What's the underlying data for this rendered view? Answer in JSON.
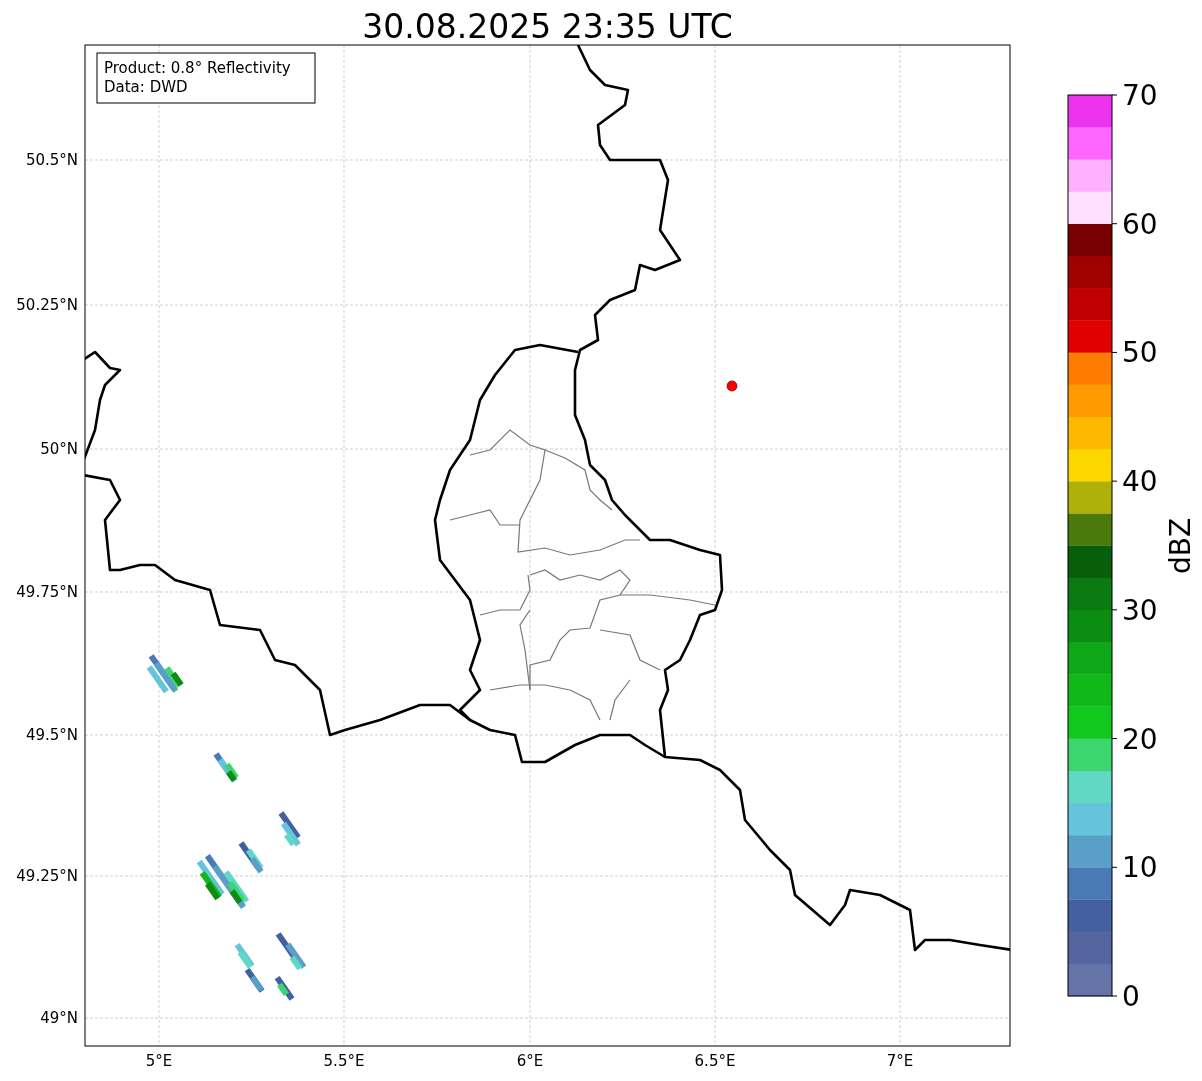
{
  "title": "30.08.2025 23:35 UTC",
  "info_box": [
    "Product: 0.8° Reflectivity",
    "Data: DWD"
  ],
  "map": {
    "lat_labels": [
      "50.5°N",
      "50.25°N",
      "50°N",
      "49.75°N",
      "49.5°N",
      "49.25°N",
      "49°N"
    ],
    "lon_labels": [
      "5°E",
      "5.5°E",
      "6°E",
      "6.5°E",
      "7°E"
    ]
  },
  "colorbar": {
    "label": "dBZ",
    "ticks": [
      "70",
      "60",
      "50",
      "40",
      "30",
      "20",
      "10",
      "0"
    ],
    "segments": [
      {
        "color": "#6473a8"
      },
      {
        "color": "#5565a0"
      },
      {
        "color": "#4460a0"
      },
      {
        "color": "#4a7ab5"
      },
      {
        "color": "#5a9fc8"
      },
      {
        "color": "#66c3dc"
      },
      {
        "color": "#60d8c4"
      },
      {
        "color": "#3cd56e"
      },
      {
        "color": "#10c81e"
      },
      {
        "color": "#10b81a"
      },
      {
        "color": "#0fa818"
      },
      {
        "color": "#0d8c14"
      },
      {
        "color": "#0c7a12"
      },
      {
        "color": "#095e0c"
      },
      {
        "color": "#4a7a0c"
      },
      {
        "color": "#b0b00a"
      },
      {
        "color": "#ffd700"
      },
      {
        "color": "#ffb800"
      },
      {
        "color": "#ff9a00"
      },
      {
        "color": "#ff7c00"
      },
      {
        "color": "#e00000"
      },
      {
        "color": "#c00000"
      },
      {
        "color": "#a00000"
      },
      {
        "color": "#780000"
      },
      {
        "color": "#ffe0ff"
      },
      {
        "color": "#ffb0ff"
      },
      {
        "color": "#ff66ff"
      },
      {
        "color": "#ee33ee"
      }
    ]
  }
}
